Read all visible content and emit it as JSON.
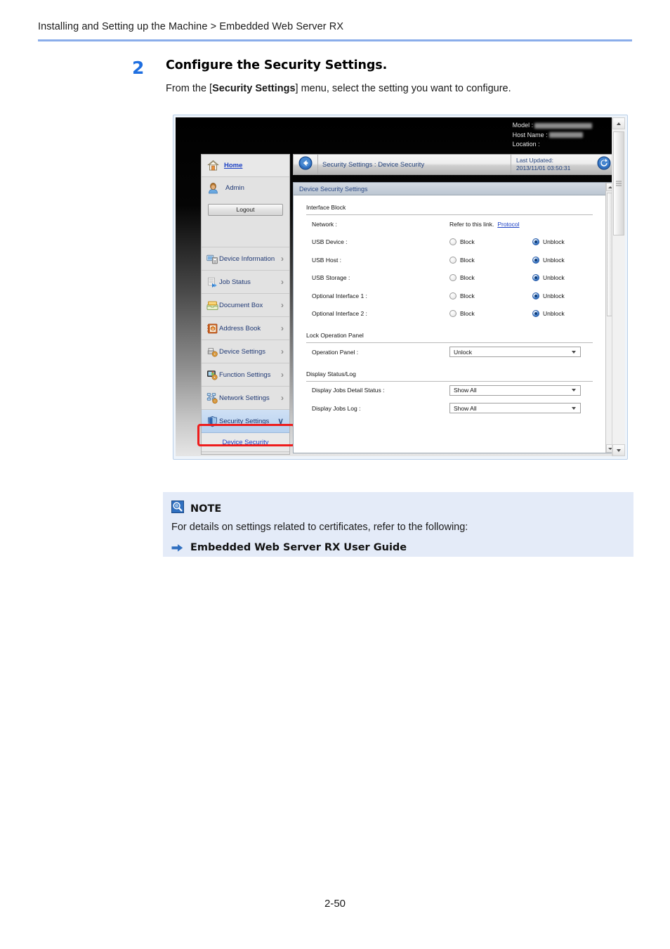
{
  "page": {
    "breadcrumb": "Installing and Setting up the Machine > Embedded Web Server RX",
    "footer": "2-50",
    "accent_blue": "#1f6fe0",
    "rule_color": "#8aadea"
  },
  "step": {
    "number": "2",
    "title": "Configure the Security Settings.",
    "body_before": "From the [",
    "body_bold": "Security Settings",
    "body_after": "] menu, select the setting you want to configure."
  },
  "screenshot": {
    "device_info": {
      "model_label": "Model :",
      "host_label": "Host Name :",
      "location_label": "Location :"
    },
    "nav": {
      "home": "Home",
      "home_icon": "house-icon",
      "user": "Admin",
      "user_icon": "user-avatar-icon",
      "logout": "Logout",
      "items": [
        {
          "label": "Device Information",
          "icon": "device-information-icon",
          "chevron": "›",
          "active": false
        },
        {
          "label": "Job Status",
          "icon": "job-status-icon",
          "chevron": "›",
          "active": false
        },
        {
          "label": "Document Box",
          "icon": "document-box-icon",
          "chevron": "›",
          "active": false
        },
        {
          "label": "Address Book",
          "icon": "address-book-icon",
          "chevron": "›",
          "active": false
        },
        {
          "label": "Device Settings",
          "icon": "device-settings-icon",
          "chevron": "›",
          "active": false
        },
        {
          "label": "Function Settings",
          "icon": "function-settings-icon",
          "chevron": "›",
          "active": false
        },
        {
          "label": "Network Settings",
          "icon": "network-settings-icon",
          "chevron": "›",
          "active": false
        },
        {
          "label": "Security Settings",
          "icon": "shield-icon",
          "chevron": "∨",
          "active": true
        }
      ],
      "submenu": "Device Security",
      "highlight_color": "#ee1c1c"
    },
    "contentbar": {
      "back_icon": "back-arrow-icon",
      "title": "Security Settings : Device Security",
      "updated_label": "Last Updated:",
      "updated_value": "2013/11/01 03:50:31",
      "refresh_icon": "refresh-icon"
    },
    "panel": {
      "header": "Device Security Settings",
      "sections": [
        {
          "title": "Interface Block",
          "rows": [
            {
              "label": "Network :",
              "type": "link",
              "text": "Refer to this link.",
              "link": "Protocol"
            },
            {
              "label": "USB Device :",
              "type": "radio",
              "options": [
                "Block",
                "Unblock"
              ],
              "selected": "Unblock"
            },
            {
              "label": "USB Host :",
              "type": "radio",
              "options": [
                "Block",
                "Unblock"
              ],
              "selected": "Unblock"
            },
            {
              "label": "USB Storage :",
              "type": "radio",
              "options": [
                "Block",
                "Unblock"
              ],
              "selected": "Unblock"
            },
            {
              "label": "Optional Interface 1 :",
              "type": "radio",
              "options": [
                "Block",
                "Unblock"
              ],
              "selected": "Unblock"
            },
            {
              "label": "Optional Interface 2 :",
              "type": "radio",
              "options": [
                "Block",
                "Unblock"
              ],
              "selected": "Unblock"
            }
          ]
        },
        {
          "title": "Lock Operation Panel",
          "rows": [
            {
              "label": "Operation Panel :",
              "type": "select",
              "value": "Unlock"
            }
          ]
        },
        {
          "title": "Display Status/Log",
          "rows": [
            {
              "label": "Display Jobs Detail Status :",
              "type": "select",
              "value": "Show All"
            },
            {
              "label": "Display Jobs Log :",
              "type": "select",
              "value": "Show All"
            }
          ]
        }
      ]
    }
  },
  "note": {
    "icon": "note-magnifier-icon",
    "title": "NOTE",
    "text": "For details on settings related to certificates, refer to the following:",
    "ref_icon": "arrow-right-icon",
    "ref": "Embedded Web Server RX User Guide"
  }
}
